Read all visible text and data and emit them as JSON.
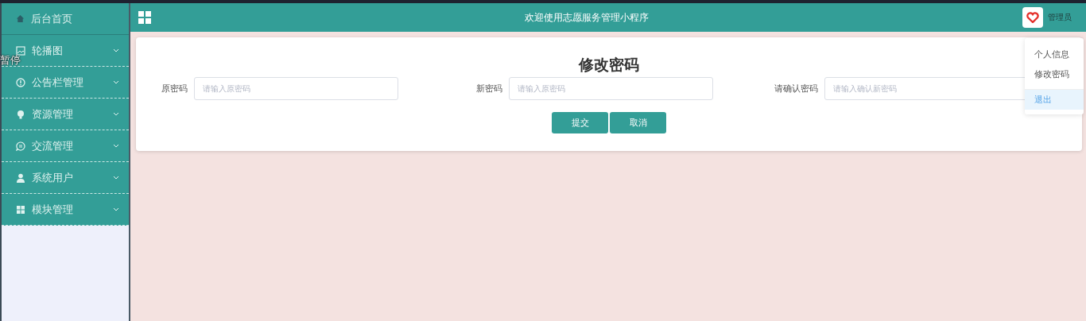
{
  "sidebar": {
    "items": [
      {
        "label": "后台首页",
        "kind": "link",
        "selected": true
      },
      {
        "label": "轮播图",
        "kind": "submenu",
        "selected": false
      },
      {
        "label": "公告栏管理",
        "kind": "submenu",
        "selected": false
      },
      {
        "label": "资源管理",
        "kind": "submenu",
        "selected": false
      },
      {
        "label": "交流管理",
        "kind": "submenu",
        "selected": false
      },
      {
        "label": "系统用户",
        "kind": "submenu",
        "selected": false
      },
      {
        "label": "模块管理",
        "kind": "submenu",
        "selected": false
      }
    ]
  },
  "overlay_label": "暂停",
  "header": {
    "title": "欢迎使用志愿服务管理小程序",
    "user": "管理员"
  },
  "user_menu": [
    {
      "label": "个人信息",
      "highlighted": false
    },
    {
      "label": "修改密码",
      "highlighted": false
    },
    {
      "label": "退出",
      "highlighted": true
    }
  ],
  "form": {
    "title": "修改密码",
    "fields": [
      {
        "label": "原密码",
        "placeholder": "请输入原密码"
      },
      {
        "label": "新密码",
        "placeholder": "请输入原密码"
      },
      {
        "label": "请确认密码",
        "placeholder": "请输入确认新密码"
      }
    ],
    "buttons": [
      "提交",
      "取消"
    ]
  }
}
